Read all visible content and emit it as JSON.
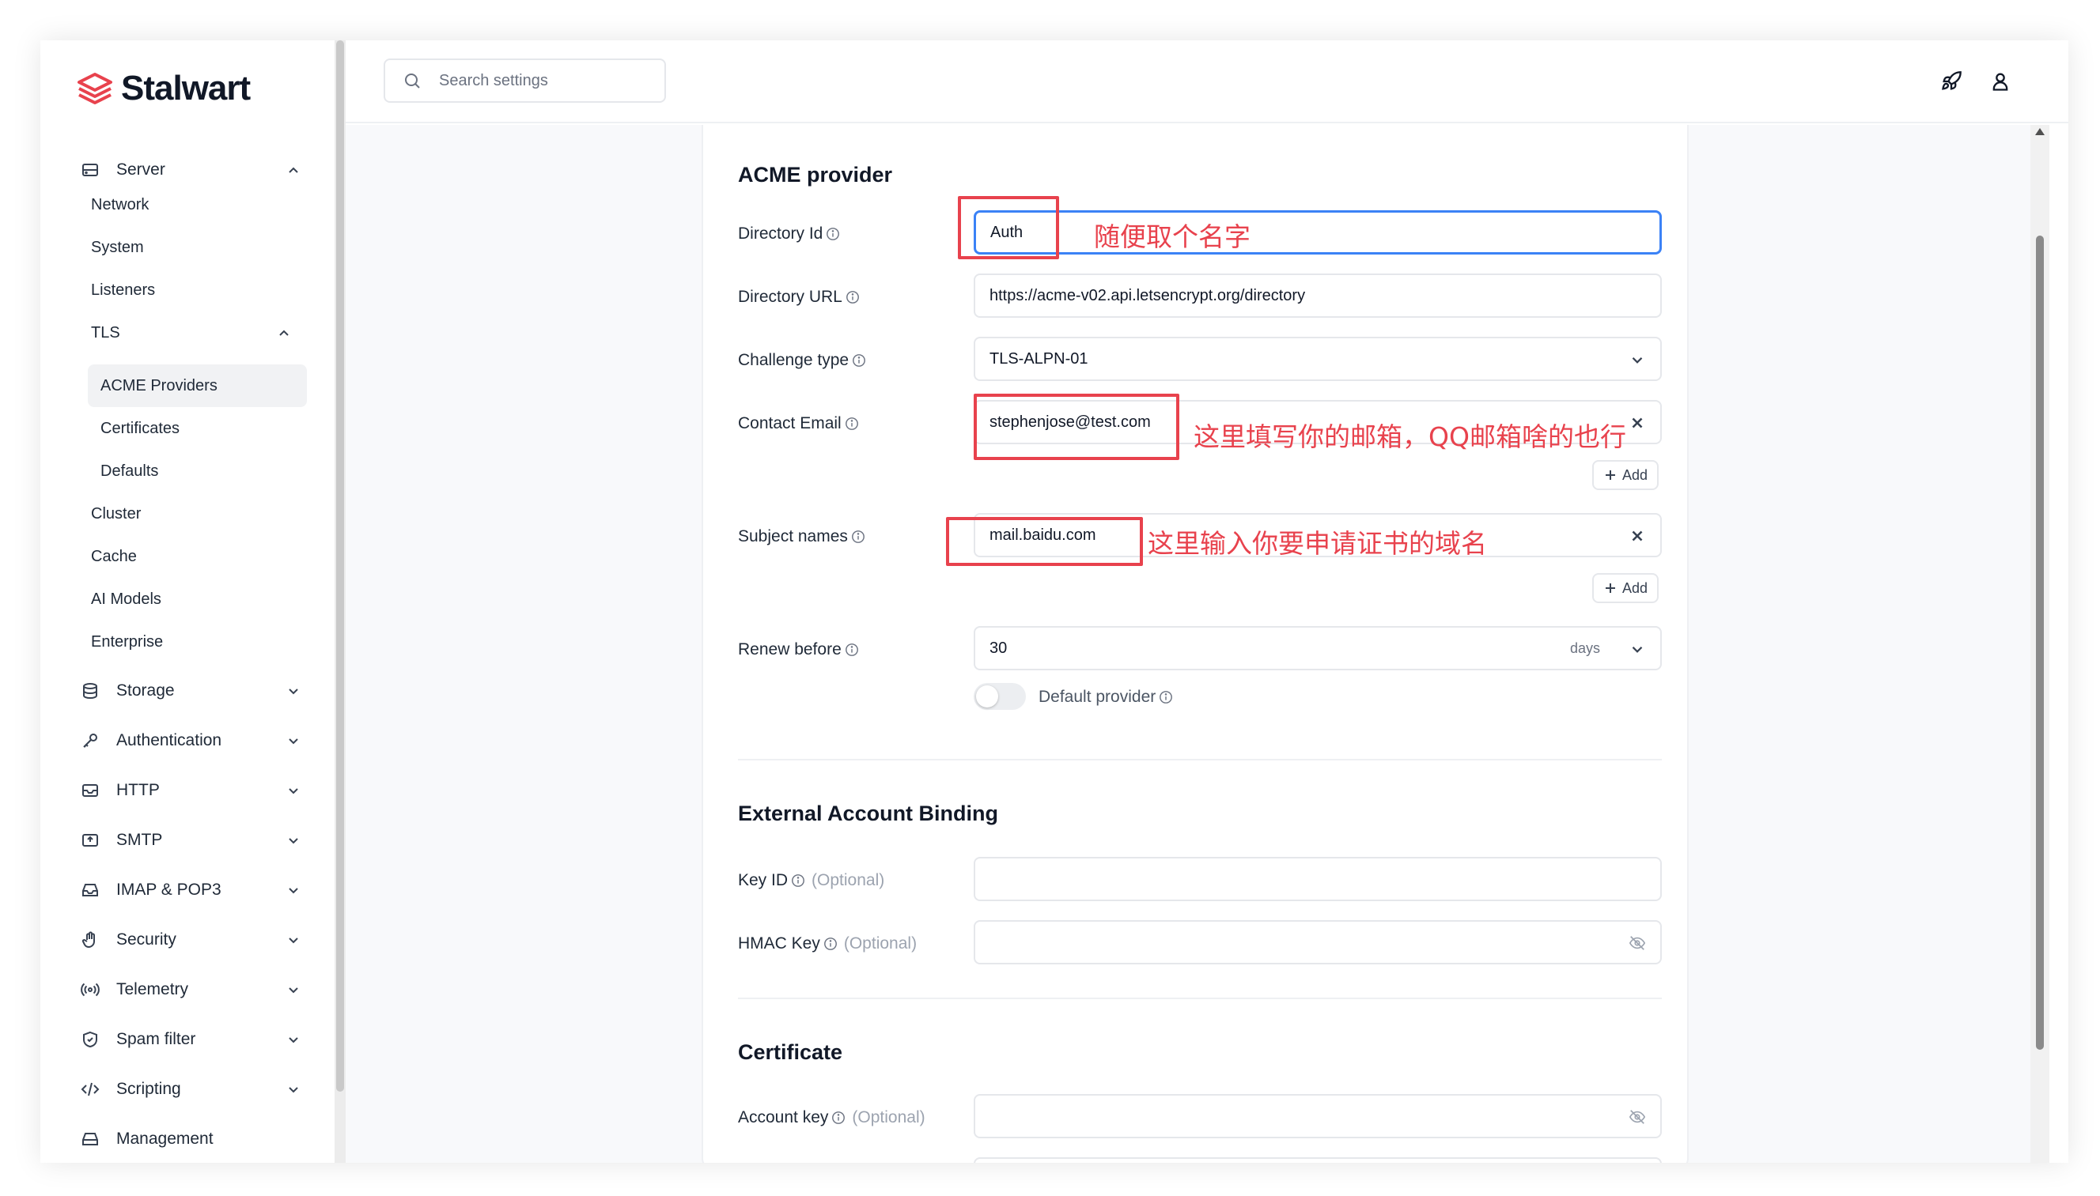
{
  "app": {
    "name": "Stalwart"
  },
  "search": {
    "placeholder": "Search settings"
  },
  "sidebar": {
    "server": {
      "label": "Server"
    },
    "server_children": [
      "Network",
      "System",
      "Listeners"
    ],
    "tls": {
      "label": "TLS"
    },
    "tls_children": [
      "ACME Providers",
      "Certificates",
      "Defaults"
    ],
    "server_children_after": [
      "Cluster",
      "Cache",
      "AI Models",
      "Enterprise"
    ],
    "sections": [
      "Storage",
      "Authentication",
      "HTTP",
      "SMTP",
      "IMAP & POP3",
      "Security",
      "Telemetry",
      "Spam filter",
      "Scripting",
      "Management"
    ]
  },
  "form": {
    "acme_title": "ACME provider",
    "directory_id": {
      "label": "Directory Id",
      "value": "Auth"
    },
    "directory_url": {
      "label": "Directory URL",
      "value": "https://acme-v02.api.letsencrypt.org/directory"
    },
    "challenge_type": {
      "label": "Challenge type",
      "value": "TLS-ALPN-01"
    },
    "contact_email": {
      "label": "Contact Email",
      "value": "stephenjose@test.com"
    },
    "subject_names": {
      "label": "Subject names",
      "value": "mail.baidu.com"
    },
    "renew_before": {
      "label": "Renew before",
      "value": "30",
      "unit": "days"
    },
    "default_provider": {
      "label": "Default provider"
    },
    "add_label": "Add",
    "eab_title": "External Account Binding",
    "key_id": {
      "label": "Key ID",
      "optional": "(Optional)"
    },
    "hmac_key": {
      "label": "HMAC Key",
      "optional": "(Optional)"
    },
    "cert_title": "Certificate",
    "account_key": {
      "label": "Account key",
      "optional": "(Optional)"
    }
  },
  "annotations": {
    "note1": "随便取个名字",
    "note2": "这里填写你的邮箱，QQ邮箱啥的也行",
    "note3": "这里输入你要申请证书的域名",
    "color": "#e8424d"
  },
  "colors": {
    "focus": "#3b82f6",
    "logo": "#e8424d"
  }
}
